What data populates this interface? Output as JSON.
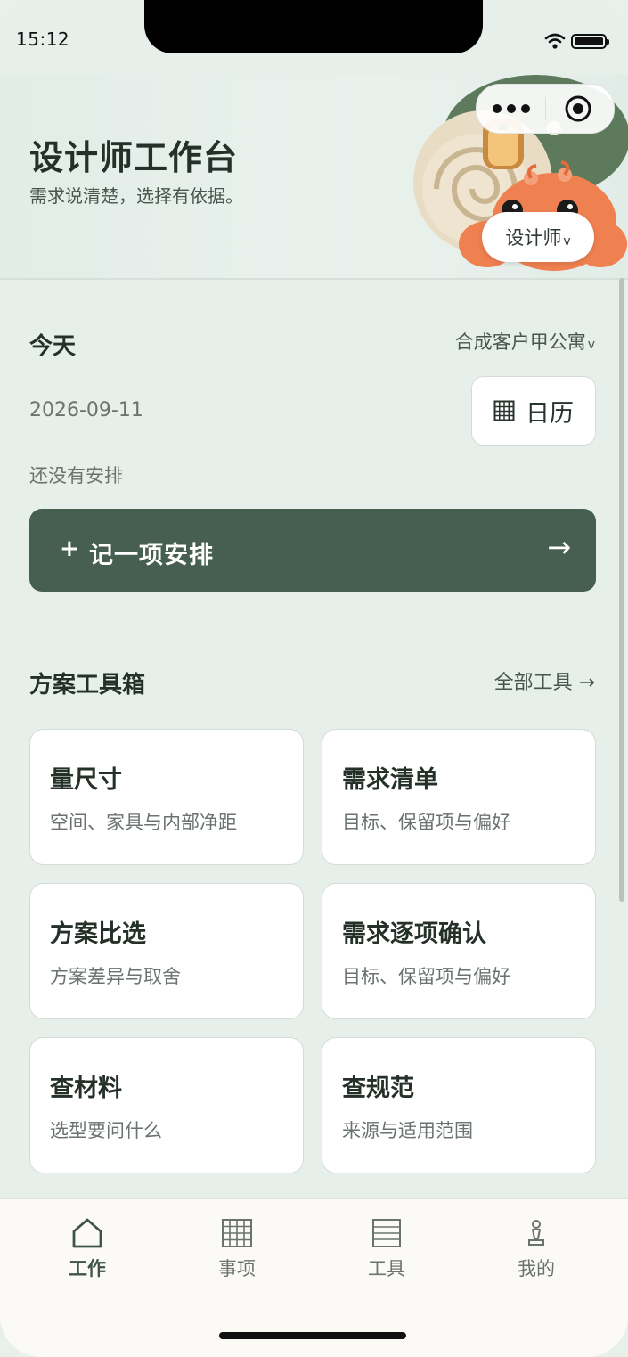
{
  "status_bar": {
    "time": "15:12"
  },
  "header": {
    "title": "设计师工作台",
    "subtitle": "需求说清楚，选择有依据。",
    "role_label": "设计师",
    "role_chevron": "v"
  },
  "today": {
    "title": "今天",
    "client_label": "合成客户甲公寓",
    "client_chevron": "v",
    "date": "2026-09-11",
    "calendar_label": "日历",
    "empty_hint": "还没有安排",
    "add_plus": "+",
    "add_label": "记一项安排",
    "add_arrow": "→"
  },
  "toolbox": {
    "title": "方案工具箱",
    "all_tools_label": "全部工具 →",
    "cards": [
      {
        "title": "量尺寸",
        "desc": "空间、家具与内部净距"
      },
      {
        "title": "需求清单",
        "desc": "目标、保留项与偏好"
      },
      {
        "title": "方案比选",
        "desc": "方案差异与取舍"
      },
      {
        "title": "需求逐项确认",
        "desc": "目标、保留项与偏好"
      },
      {
        "title": "查材料",
        "desc": "选型要问什么"
      },
      {
        "title": "查规范",
        "desc": "来源与适用范围"
      }
    ]
  },
  "tab_bar": {
    "items": [
      {
        "label": "工作",
        "icon": "home-icon",
        "active": true
      },
      {
        "label": "事项",
        "icon": "grid-icon",
        "active": false
      },
      {
        "label": "工具",
        "icon": "list-icon",
        "active": false
      },
      {
        "label": "我的",
        "icon": "pawn-icon",
        "active": false
      }
    ]
  },
  "colors": {
    "primary": "#475f50",
    "background": "#e7efea",
    "card": "#ffffff",
    "text_dark": "#253029",
    "text_muted": "#6b736e"
  }
}
